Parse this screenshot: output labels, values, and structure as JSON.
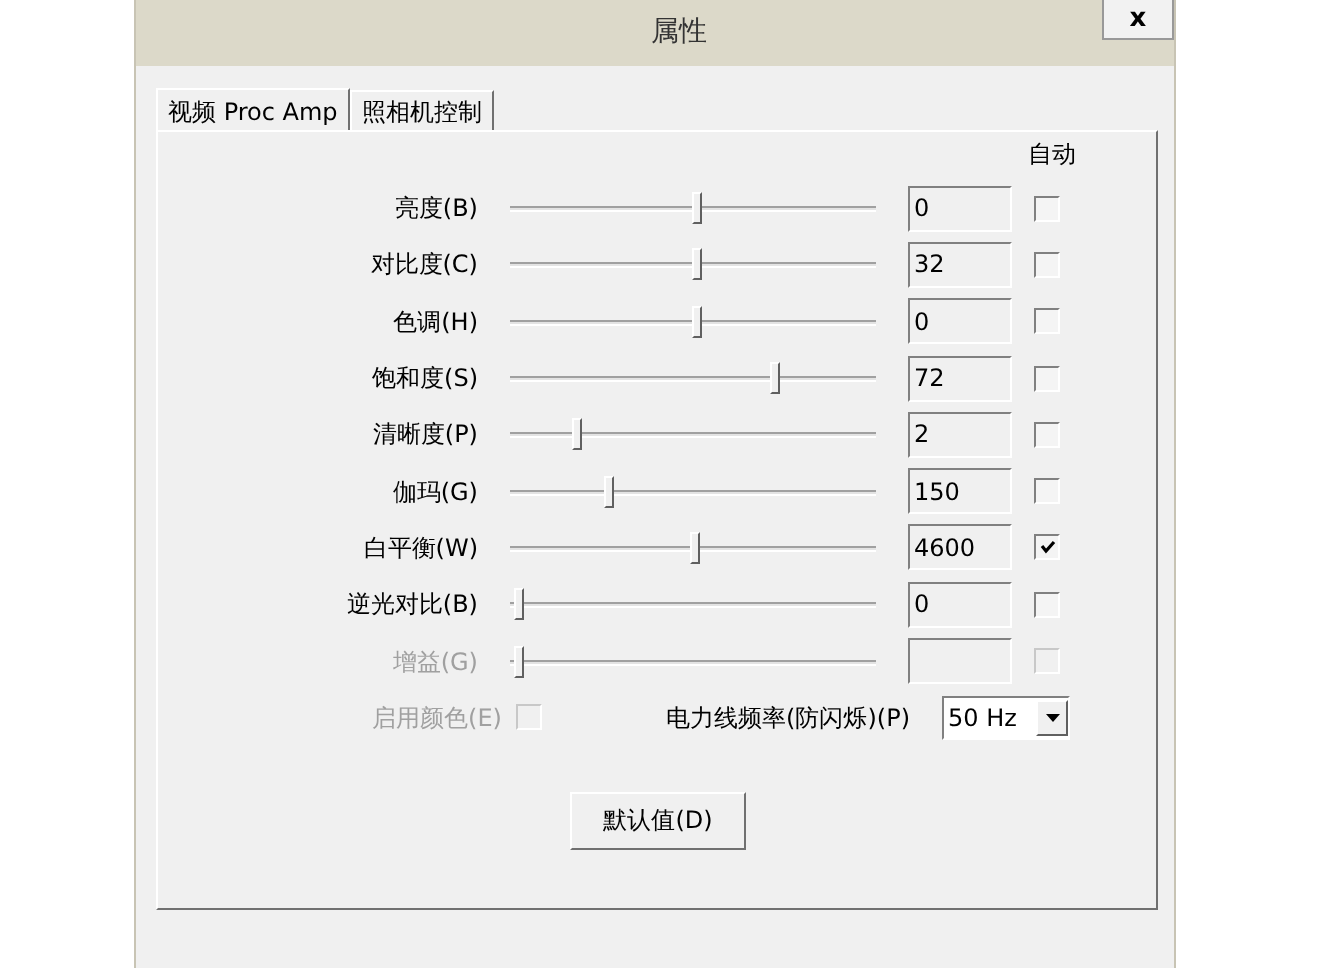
{
  "window": {
    "title": "属性",
    "close": "x"
  },
  "tabs": [
    {
      "label": "视频 Proc Amp",
      "selected": true
    },
    {
      "label": "照相机控制",
      "selected": false
    }
  ],
  "auto_header": "自动",
  "rows": [
    {
      "label": "亮度(B)",
      "level": 0.51,
      "value": "0",
      "checked": false,
      "disabled": false
    },
    {
      "label": "对比度(C)",
      "level": 0.51,
      "value": "32",
      "checked": false,
      "disabled": false
    },
    {
      "label": "色调(H)",
      "level": 0.51,
      "value": "0",
      "checked": false,
      "disabled": false
    },
    {
      "label": "饱和度(S)",
      "level": 0.72,
      "value": "72",
      "checked": false,
      "disabled": false
    },
    {
      "label": "清晰度(P)",
      "level": 0.18,
      "value": "2",
      "checked": false,
      "disabled": false
    },
    {
      "label": "伽玛(G)",
      "level": 0.27,
      "value": "150",
      "checked": false,
      "disabled": false
    },
    {
      "label": "白平衡(W)",
      "level": 0.5,
      "value": "4600",
      "checked": true,
      "disabled": false
    },
    {
      "label": "逆光对比(B)",
      "level": 0.02,
      "value": "0",
      "checked": false,
      "disabled": false
    },
    {
      "label": "增益(G)",
      "level": 0.02,
      "checked": false,
      "disabled": true
    }
  ],
  "enable_color": {
    "label": "启用颜色(E)",
    "checked": false,
    "disabled": true
  },
  "power_line": {
    "label": "电力线频率(防闪烁)(P)",
    "value": "50 Hz"
  },
  "default_button": "默认值(D)"
}
